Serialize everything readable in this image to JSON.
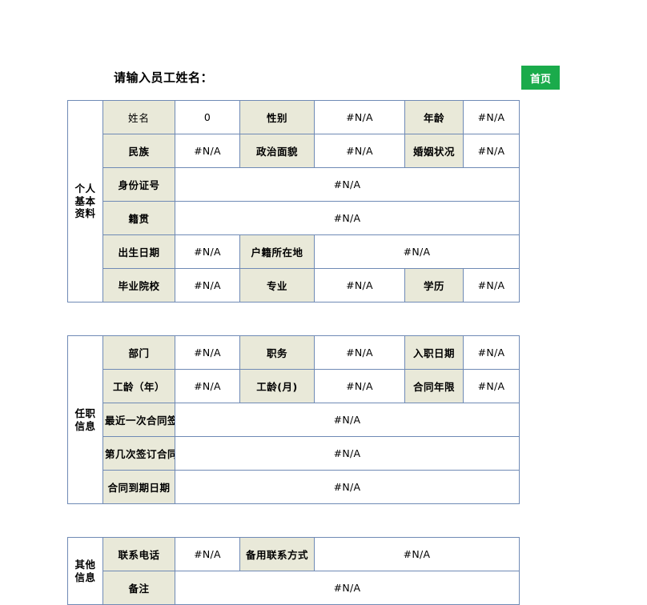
{
  "header": {
    "prompt": "请输入员工姓名：",
    "home_button": "首页",
    "home_button_color": "#1aab4b"
  },
  "colors": {
    "label_bg": "#e9e9d9",
    "value_bg": "#ffffff",
    "grid_line": "#6f8ab5",
    "accent_green": "#1aab4b"
  },
  "sections": [
    {
      "name": "个人基本资料",
      "line1": "个人",
      "line2": "基本",
      "line3": "资料",
      "rows": [
        {
          "cells": [
            {
              "kind": "label-thin",
              "text": "姓名"
            },
            {
              "kind": "value",
              "text": "0"
            },
            {
              "kind": "label",
              "text": "性别"
            },
            {
              "kind": "value",
              "text": "#N/A"
            },
            {
              "kind": "label",
              "text": "年龄"
            },
            {
              "kind": "value",
              "text": "#N/A"
            }
          ]
        },
        {
          "cells": [
            {
              "kind": "label",
              "text": "民族"
            },
            {
              "kind": "value",
              "text": "#N/A"
            },
            {
              "kind": "label",
              "text": "政治面貌"
            },
            {
              "kind": "value",
              "text": "#N/A"
            },
            {
              "kind": "label",
              "text": "婚姻状况"
            },
            {
              "kind": "value",
              "text": "#N/A"
            }
          ]
        },
        {
          "cells": [
            {
              "kind": "label",
              "text": "身份证号"
            },
            {
              "kind": "value",
              "text": "#N/A"
            }
          ]
        },
        {
          "cells": [
            {
              "kind": "label",
              "text": "籍贯"
            },
            {
              "kind": "value",
              "text": "#N/A"
            }
          ]
        },
        {
          "cells": [
            {
              "kind": "label",
              "text": "出生日期"
            },
            {
              "kind": "value",
              "text": "#N/A"
            },
            {
              "kind": "label",
              "text": "户籍所在地"
            },
            {
              "kind": "value",
              "text": "#N/A"
            }
          ]
        },
        {
          "cells": [
            {
              "kind": "label",
              "text": "毕业院校"
            },
            {
              "kind": "value",
              "text": "#N/A"
            },
            {
              "kind": "label",
              "text": "专业"
            },
            {
              "kind": "value",
              "text": "#N/A"
            },
            {
              "kind": "label",
              "text": "学历"
            },
            {
              "kind": "value",
              "text": "#N/A"
            }
          ]
        }
      ]
    },
    {
      "name": "任职信息",
      "line1": "任职",
      "line2": "信息",
      "line3": "",
      "rows": [
        {
          "cells": [
            {
              "kind": "label",
              "text": "部门"
            },
            {
              "kind": "value",
              "text": "#N/A"
            },
            {
              "kind": "label",
              "text": "职务"
            },
            {
              "kind": "value",
              "text": "#N/A"
            },
            {
              "kind": "label",
              "text": "入职日期"
            },
            {
              "kind": "value",
              "text": "#N/A"
            }
          ]
        },
        {
          "cells": [
            {
              "kind": "label",
              "text": "工龄（年）"
            },
            {
              "kind": "value",
              "text": "#N/A"
            },
            {
              "kind": "label",
              "text": "工龄(月)"
            },
            {
              "kind": "value",
              "text": "#N/A"
            },
            {
              "kind": "label",
              "text": "合同年限"
            },
            {
              "kind": "value",
              "text": "#N/A"
            }
          ]
        },
        {
          "cells": [
            {
              "kind": "label",
              "text": "最近一次合同签订日期"
            },
            {
              "kind": "value",
              "text": "#N/A"
            }
          ]
        },
        {
          "cells": [
            {
              "kind": "label",
              "text": "第几次签订合同"
            },
            {
              "kind": "value",
              "text": "#N/A"
            }
          ]
        },
        {
          "cells": [
            {
              "kind": "label",
              "text": "合同到期日期"
            },
            {
              "kind": "value",
              "text": "#N/A"
            }
          ]
        }
      ]
    },
    {
      "name": "其他信息",
      "line1": "其他",
      "line2": "信息",
      "line3": "",
      "rows": [
        {
          "cells": [
            {
              "kind": "label",
              "text": "联系电话"
            },
            {
              "kind": "value",
              "text": "#N/A"
            },
            {
              "kind": "label",
              "text": "备用联系方式"
            },
            {
              "kind": "value",
              "text": "#N/A"
            }
          ]
        },
        {
          "cells": [
            {
              "kind": "label",
              "text": "备注"
            },
            {
              "kind": "value",
              "text": "#N/A"
            }
          ]
        }
      ]
    }
  ]
}
